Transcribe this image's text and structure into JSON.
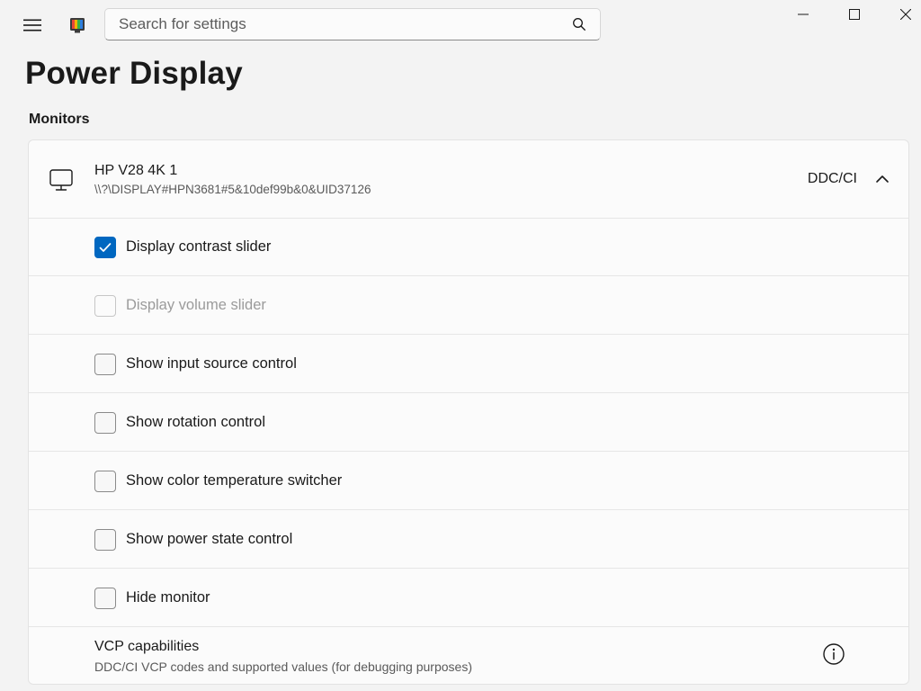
{
  "app": {
    "menu_icon": "hamburger-menu-icon",
    "logo_icon": "power-display-logo-icon"
  },
  "search": {
    "placeholder": "Search for settings",
    "value": "",
    "icon": "search-icon"
  },
  "window_controls": {
    "minimize_icon": "minimize-icon",
    "maximize_icon": "maximize-icon",
    "close_icon": "close-icon"
  },
  "page": {
    "title": "Power Display",
    "section_header": "Monitors"
  },
  "monitor": {
    "icon": "monitor-icon",
    "name": "HP V28 4K 1",
    "path": "\\\\?\\DISPLAY#HPN3681#5&10def99b&0&UID37126",
    "protocol": "DDC/CI",
    "expanded": true,
    "chevron_icon": "chevron-up-icon"
  },
  "options": [
    {
      "label": "Display contrast slider",
      "checked": true,
      "disabled": false
    },
    {
      "label": "Display volume slider",
      "checked": false,
      "disabled": true
    },
    {
      "label": "Show input source control",
      "checked": false,
      "disabled": false
    },
    {
      "label": "Show rotation control",
      "checked": false,
      "disabled": false
    },
    {
      "label": "Show color temperature switcher",
      "checked": false,
      "disabled": false
    },
    {
      "label": "Show power state control",
      "checked": false,
      "disabled": false
    },
    {
      "label": "Hide monitor",
      "checked": false,
      "disabled": false
    }
  ],
  "vcp": {
    "title": "VCP capabilities",
    "description": "DDC/CI VCP codes and supported values (for debugging purposes)",
    "info_icon": "info-icon"
  },
  "colors": {
    "accent": "#0067c0",
    "background": "#f3f3f3",
    "card": "#fbfbfb"
  }
}
